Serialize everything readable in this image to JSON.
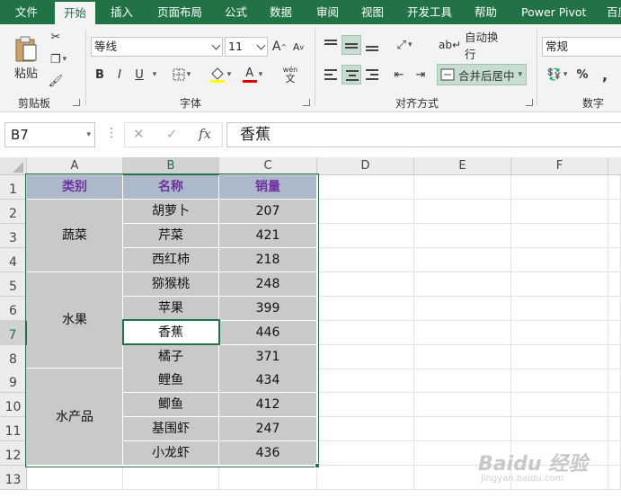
{
  "tabs": [
    "文件",
    "开始",
    "插入",
    "页面布局",
    "公式",
    "数据",
    "审阅",
    "视图",
    "开发工具",
    "帮助",
    "Power Pivot",
    "百度"
  ],
  "active_tab": "开始",
  "ribbon": {
    "clipboard": {
      "paste_label": "粘贴",
      "group_label": "剪贴板"
    },
    "font": {
      "font_name": "等线",
      "font_size": "11",
      "bold": "B",
      "italic": "I",
      "underline": "U",
      "grow": "A",
      "shrink": "A",
      "font_color_glyph": "A",
      "phonetic_glyph": "文",
      "phonetic_top": "wén",
      "group_label": "字体"
    },
    "alignment": {
      "wrap_label": "自动换行",
      "merge_label": "合并后居中",
      "group_label": "对齐方式"
    },
    "number": {
      "format": "常规",
      "percent": "%",
      "comma": ",",
      "group_label": "数字"
    }
  },
  "formula_bar": {
    "name_box": "B7",
    "fx": "fx",
    "content": "香蕉"
  },
  "columns": [
    "A",
    "B",
    "C",
    "D",
    "E",
    "F"
  ],
  "rows": [
    "1",
    "2",
    "3",
    "4",
    "5",
    "6",
    "7",
    "8",
    "9",
    "10",
    "11",
    "12",
    "13"
  ],
  "table": {
    "headers": {
      "category": "类别",
      "name": "名称",
      "sales": "销量"
    },
    "groups": [
      {
        "category": "蔬菜",
        "items": [
          {
            "name": "胡萝卜",
            "sales": "207"
          },
          {
            "name": "芹菜",
            "sales": "421"
          },
          {
            "name": "西红柿",
            "sales": "218"
          }
        ]
      },
      {
        "category": "水果",
        "items": [
          {
            "name": "猕猴桃",
            "sales": "248"
          },
          {
            "name": "苹果",
            "sales": "399"
          },
          {
            "name": "香蕉",
            "sales": "446"
          },
          {
            "name": "橘子",
            "sales": "371"
          }
        ]
      },
      {
        "category": "水产品",
        "items": [
          {
            "name": "鲤鱼",
            "sales": "434"
          },
          {
            "name": "鲫鱼",
            "sales": "412"
          },
          {
            "name": "基围虾",
            "sales": "247"
          },
          {
            "name": "小龙虾",
            "sales": "436"
          }
        ]
      }
    ]
  },
  "selected_cell": "B7",
  "colors": {
    "accent": "#217346",
    "header_fill": "#acb9ca",
    "header_text": "#7030a0",
    "data_fill": "#c9c9c9"
  },
  "watermark": {
    "brand": "Baidu 经验",
    "url": "jingyan.baidu.com"
  }
}
